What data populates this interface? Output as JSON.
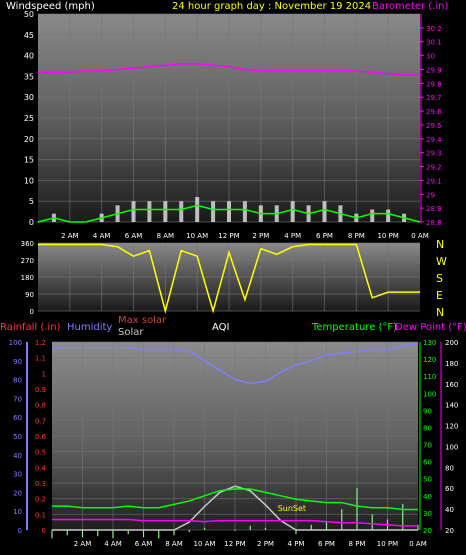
{
  "header": {
    "left_label": "Windspeed (mph)",
    "center_title": "24 hour graph day : November 19 2024",
    "right_label": "Barometer (.in)"
  },
  "colors": {
    "windspeed": "#ffffff",
    "wind_gust": "#d8d8d8",
    "wind_avg": "#00ff00",
    "barometer": "#ff00ff",
    "direction": "#ffff00",
    "rainfall": "#ff3333",
    "humidity": "#8080ff",
    "max_solar": "#cc4444",
    "solar": "#c8c8c8",
    "aqi": "#ffffff",
    "temperature": "#00ff00",
    "dew_point": "#ff00ff",
    "sunset_text": "#ffff00",
    "time_labels": "#ffffff"
  },
  "time_labels": [
    "2 AM",
    "4 AM",
    "6 AM",
    "8 AM",
    "10 AM",
    "12 PM",
    "2 PM",
    "4 PM",
    "6 PM",
    "8 PM",
    "10 PM",
    "0 AM"
  ],
  "compass_labels": [
    "N",
    "W",
    "S",
    "E",
    "N"
  ],
  "lower_legend": {
    "rainfall": "Rainfall (.in)",
    "humidity": "Humidity",
    "max_solar": "Max solar",
    "solar": "Solar",
    "aqi": "AQI",
    "temperature": "Temperature (°F)",
    "dew_point": "Dew Point (°F)",
    "sunset": "SunSet"
  },
  "chart_data": [
    {
      "type": "line",
      "title": "24 hour graph day : November 19 2024",
      "x": [
        0,
        1,
        2,
        3,
        4,
        5,
        6,
        7,
        8,
        9,
        10,
        11,
        12,
        13,
        14,
        15,
        16,
        17,
        18,
        19,
        20,
        21,
        22,
        23,
        24
      ],
      "series": [
        {
          "name": "Windspeed (mph)",
          "axis": "left",
          "values": [
            0,
            1,
            0,
            0,
            1,
            2,
            3,
            3,
            3,
            3,
            4,
            3,
            3,
            3,
            2,
            2,
            3,
            2,
            3,
            2,
            1,
            2,
            2,
            1,
            0
          ]
        },
        {
          "name": "Barometer (.in)",
          "axis": "right",
          "values": [
            29.88,
            29.88,
            29.88,
            29.89,
            29.89,
            29.9,
            29.91,
            29.92,
            29.93,
            29.94,
            29.94,
            29.93,
            29.92,
            29.9,
            29.89,
            29.89,
            29.89,
            29.89,
            29.89,
            29.89,
            29.89,
            29.88,
            29.87,
            29.86,
            29.86
          ]
        }
      ],
      "gust_values": [
        0,
        2,
        0,
        0,
        2,
        4,
        5,
        5,
        5,
        5,
        6,
        5,
        5,
        5,
        4,
        4,
        5,
        4,
        5,
        4,
        2,
        3,
        3,
        2,
        0
      ],
      "ylim_left": [
        0,
        50
      ],
      "yticks_left": [
        0,
        5,
        10,
        15,
        20,
        25,
        30,
        35,
        40,
        45,
        50
      ],
      "ylim_right": [
        28.8,
        30.3
      ],
      "yticks_right": [
        28.8,
        28.9,
        29,
        29.1,
        29.2,
        29.3,
        29.4,
        29.5,
        29.6,
        29.7,
        29.8,
        29.9,
        30,
        30.1,
        30.2
      ],
      "grid": true
    },
    {
      "type": "line",
      "title": "",
      "x": [
        0,
        1,
        2,
        3,
        4,
        5,
        6,
        7,
        8,
        9,
        10,
        11,
        12,
        13,
        14,
        15,
        16,
        17,
        18,
        19,
        20,
        21,
        22,
        23,
        24
      ],
      "series": [
        {
          "name": "Wind direction",
          "values": [
            352,
            352,
            352,
            352,
            352,
            340,
            290,
            320,
            0,
            320,
            290,
            0,
            310,
            60,
            330,
            300,
            340,
            352,
            352,
            352,
            352,
            70,
            100,
            100,
            100
          ]
        }
      ],
      "ylim": [
        0,
        360
      ],
      "yticks": [
        0,
        90,
        180,
        270,
        360
      ],
      "grid": true
    },
    {
      "type": "line",
      "title": "",
      "x": [
        0,
        1,
        2,
        3,
        4,
        5,
        6,
        7,
        8,
        9,
        10,
        11,
        12,
        13,
        14,
        15,
        16,
        17,
        18,
        19,
        20,
        21,
        22,
        23,
        24
      ],
      "series": [
        {
          "name": "Humidity",
          "axis": "left2",
          "values": [
            97,
            97,
            97,
            97,
            97,
            97,
            96,
            96,
            96,
            95,
            90,
            85,
            80,
            78,
            79,
            84,
            88,
            90,
            93,
            94,
            95,
            96,
            96,
            98,
            99
          ]
        },
        {
          "name": "Temperature (°F)",
          "axis": "right1",
          "values": [
            34,
            34,
            33,
            33,
            33,
            34,
            33,
            33,
            35,
            37,
            40,
            43,
            44,
            44,
            42,
            40,
            38,
            37,
            36,
            36,
            34,
            33,
            33,
            32,
            32
          ]
        },
        {
          "name": "Dew Point (°F)",
          "axis": "right2",
          "values": [
            30,
            30,
            30,
            30,
            30,
            30,
            29,
            29,
            29,
            29,
            28,
            29,
            29,
            29,
            29,
            29,
            29,
            29,
            28,
            27,
            27,
            26,
            25,
            24,
            24
          ]
        },
        {
          "name": "Solar",
          "axis": "left1",
          "values": [
            0,
            0,
            0,
            0,
            0,
            0,
            0,
            0,
            0,
            0.05,
            0.15,
            0.24,
            0.28,
            0.25,
            0.16,
            0.06,
            0,
            0,
            0,
            0,
            0,
            0,
            0,
            0,
            0
          ]
        },
        {
          "name": "AQI",
          "axis": "right2",
          "values": [
            12,
            15,
            13,
            14,
            12,
            16,
            13,
            12,
            15,
            18,
            22,
            20,
            19,
            24,
            22,
            20,
            16,
            25,
            28,
            40,
            60,
            35,
            30,
            45,
            25
          ]
        }
      ],
      "ylim_left_rainfall": [
        0,
        1.2
      ],
      "yticks_left_rainfall": [
        0,
        0.1,
        0.2,
        0.3,
        0.4,
        0.5,
        0.6,
        0.7,
        0.8,
        0.9,
        1,
        1.1,
        1.2
      ],
      "ylim_left_humidity": [
        0,
        100
      ],
      "yticks_left_humidity": [
        0,
        10,
        20,
        30,
        40,
        50,
        60,
        70,
        80,
        90,
        100
      ],
      "ylim_right_temperature": [
        20,
        130
      ],
      "yticks_right_temperature": [
        20,
        30,
        40,
        50,
        60,
        70,
        80,
        90,
        100,
        110,
        120,
        130
      ],
      "ylim_right_dewpoint": [
        20,
        200
      ],
      "yticks_right_dewpoint": [
        20,
        40,
        60,
        80,
        100,
        120,
        140,
        160,
        180,
        200
      ],
      "grid": true
    }
  ]
}
